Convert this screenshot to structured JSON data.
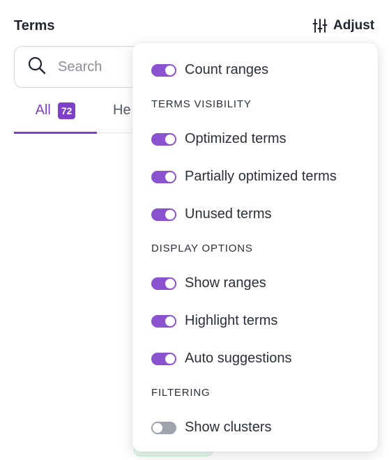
{
  "header": {
    "title": "Terms",
    "adjust_label": "Adjust",
    "adjust_icon": "sliders-icon"
  },
  "search": {
    "placeholder": "Search",
    "value": "",
    "icon": "search-icon"
  },
  "tabs": [
    {
      "label": "All",
      "count": "72",
      "active": true
    },
    {
      "label": "He",
      "active": false
    }
  ],
  "dropdown": {
    "items": [
      {
        "label": "Count ranges",
        "enabled": true
      },
      {
        "label": "Optimized terms",
        "enabled": true
      },
      {
        "label": "Partially optimized terms",
        "enabled": true
      },
      {
        "label": "Unused terms",
        "enabled": true
      },
      {
        "label": "Show ranges",
        "enabled": true
      },
      {
        "label": "Highlight terms",
        "enabled": true
      },
      {
        "label": "Auto suggestions",
        "enabled": true
      },
      {
        "label": "Show clusters",
        "enabled": false
      }
    ],
    "sections": {
      "terms_visibility": "TERMS VISIBILITY",
      "display_options": "DISPLAY OPTIONS",
      "filtering": "FILTERING"
    }
  },
  "colors": {
    "accent": "#7e3fc9",
    "toggle_on": "#8a52cf",
    "toggle_off": "#9ea3ad"
  }
}
